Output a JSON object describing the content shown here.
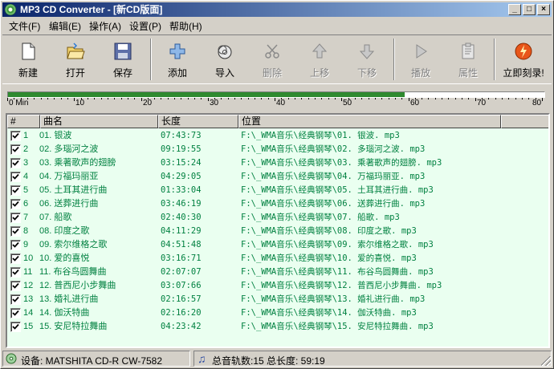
{
  "window": {
    "title": "MP3 CD Converter - [新CD版面]",
    "controls": {
      "minimize": "_",
      "maximize": "□",
      "close": "×"
    }
  },
  "menu": [
    {
      "label": "文件(F)"
    },
    {
      "label": "编辑(E)"
    },
    {
      "label": "操作(A)"
    },
    {
      "label": "设置(P)"
    },
    {
      "label": "帮助(H)"
    }
  ],
  "toolbar": {
    "new": "新建",
    "open": "打开",
    "save": "保存",
    "add": "添加",
    "import": "导入",
    "delete": "删除",
    "move_up": "上移",
    "move_down": "下移",
    "play": "播放",
    "properties": "属性",
    "burn": "立即刻录!"
  },
  "progress": {
    "fraction": 0.74,
    "ruler_labels": [
      "0 Min",
      "10",
      "20",
      "30",
      "40",
      "50",
      "60",
      "70",
      "80"
    ]
  },
  "list": {
    "columns": {
      "num": "#",
      "name": "曲名",
      "length": "长度",
      "location": "位置"
    },
    "rows": [
      {
        "num": "1",
        "name": "01. 银波",
        "length": "07:43:73",
        "path": "F:\\_WMA音乐\\经典钢琴\\01. 银波. mp3"
      },
      {
        "num": "2",
        "name": "02. 多瑙河之波",
        "length": "09:19:55",
        "path": "F:\\_WMA音乐\\经典钢琴\\02. 多瑙河之波. mp3"
      },
      {
        "num": "3",
        "name": "03. 乘著歌声的翅膀",
        "length": "03:15:24",
        "path": "F:\\_WMA音乐\\经典钢琴\\03. 乘著歌声的翅膀. mp3"
      },
      {
        "num": "4",
        "name": "04. 万福玛丽亚",
        "length": "04:29:05",
        "path": "F:\\_WMA音乐\\经典钢琴\\04. 万福玛丽亚. mp3"
      },
      {
        "num": "5",
        "name": "05. 土耳其进行曲",
        "length": "01:33:04",
        "path": "F:\\_WMA音乐\\经典钢琴\\05. 土耳其进行曲. mp3"
      },
      {
        "num": "6",
        "name": "06. 送葬进行曲",
        "length": "03:46:19",
        "path": "F:\\_WMA音乐\\经典钢琴\\06. 送葬进行曲. mp3"
      },
      {
        "num": "7",
        "name": "07. 船歌",
        "length": "02:40:30",
        "path": "F:\\_WMA音乐\\经典钢琴\\07. 船歌. mp3"
      },
      {
        "num": "8",
        "name": "08. 印度之歌",
        "length": "04:11:29",
        "path": "F:\\_WMA音乐\\经典钢琴\\08. 印度之歌. mp3"
      },
      {
        "num": "9",
        "name": "09. 索尔维格之歌",
        "length": "04:51:48",
        "path": "F:\\_WMA音乐\\经典钢琴\\09. 索尔维格之歌. mp3"
      },
      {
        "num": "10",
        "name": "10. 爱的喜悦",
        "length": "03:16:71",
        "path": "F:\\_WMA音乐\\经典钢琴\\10. 爱的喜悦. mp3"
      },
      {
        "num": "11",
        "name": "11. 布谷鸟圆舞曲",
        "length": "02:07:07",
        "path": "F:\\_WMA音乐\\经典钢琴\\11. 布谷鸟圆舞曲. mp3"
      },
      {
        "num": "12",
        "name": "12. 普西尼小步舞曲",
        "length": "03:07:66",
        "path": "F:\\_WMA音乐\\经典钢琴\\12. 普西尼小步舞曲. mp3"
      },
      {
        "num": "13",
        "name": "13. 婚礼进行曲",
        "length": "02:16:57",
        "path": "F:\\_WMA音乐\\经典钢琴\\13. 婚礼进行曲. mp3"
      },
      {
        "num": "14",
        "name": "14. 伽沃特曲",
        "length": "02:16:20",
        "path": "F:\\_WMA音乐\\经典钢琴\\14. 伽沃特曲. mp3"
      },
      {
        "num": "15",
        "name": "15. 安尼特拉舞曲",
        "length": "04:23:42",
        "path": "F:\\_WMA音乐\\经典钢琴\\15. 安尼特拉舞曲. mp3"
      }
    ]
  },
  "status": {
    "device": "设备: MATSHITA  CD-R   CW-7582",
    "summary": "总音轨数:15 总长度: 59:19"
  },
  "colors": {
    "accent_green": "#2f8a2f",
    "list_text": "#008040",
    "list_bg": "#eafff0"
  }
}
